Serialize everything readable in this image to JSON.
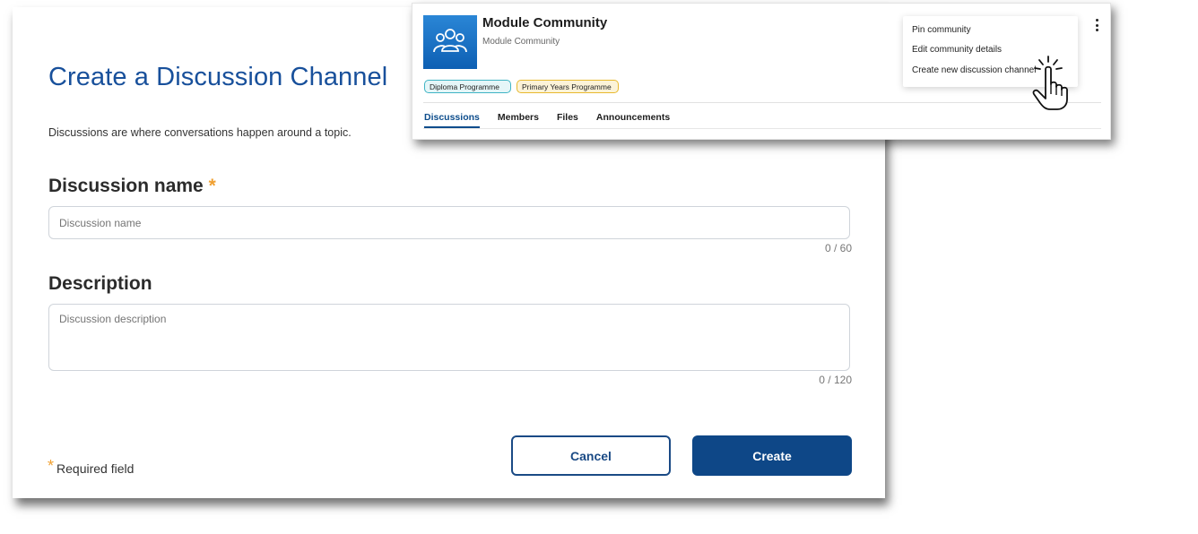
{
  "form": {
    "title": "Create a Discussion Channel",
    "subtitle": "Discussions are where conversations happen around a topic.",
    "name_label": "Discussion name",
    "required_star": "*",
    "name_placeholder": "Discussion name",
    "name_counter": "0 / 60",
    "description_label": "Description",
    "description_placeholder": "Discussion description",
    "description_counter": "0 / 120",
    "required_note": "Required field",
    "cancel_label": "Cancel",
    "create_label": "Create"
  },
  "community": {
    "title": "Module Community",
    "subtitle": "Module Community",
    "avatar_icon": "group-icon",
    "tags": [
      {
        "label": "Diploma Programme",
        "color": "#3fb4c4"
      },
      {
        "label": "Primary Years Programme",
        "color": "#e8b92f"
      }
    ],
    "tabs": [
      {
        "label": "Discussions",
        "active": true
      },
      {
        "label": "Members",
        "active": false
      },
      {
        "label": "Files",
        "active": false
      },
      {
        "label": "Announcements",
        "active": false
      }
    ],
    "menu_items": [
      {
        "label": "Pin community"
      },
      {
        "label": "Edit community details"
      },
      {
        "label": "Create new discussion channel"
      }
    ]
  },
  "colors": {
    "brand_blue": "#18509b",
    "button_blue": "#0e4787",
    "required_orange": "#f0a031"
  }
}
